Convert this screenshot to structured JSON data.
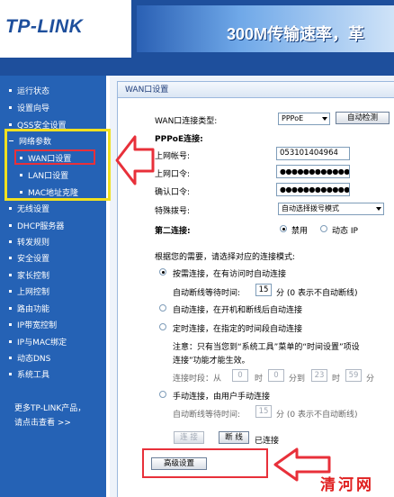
{
  "header": {
    "logo": "TP-LINK",
    "slogan": "300M传输速率，",
    "slogan_extra": "革"
  },
  "sidebar": {
    "items": [
      {
        "label": "运行状态"
      },
      {
        "label": "设置向导"
      },
      {
        "label": "QSS安全设置"
      },
      {
        "label": "网络参数"
      },
      {
        "label": "WAN口设置"
      },
      {
        "label": "LAN口设置"
      },
      {
        "label": "MAC地址克隆"
      },
      {
        "label": "无线设置"
      },
      {
        "label": "DHCP服务器"
      },
      {
        "label": "转发规则"
      },
      {
        "label": "安全设置"
      },
      {
        "label": "家长控制"
      },
      {
        "label": "上网控制"
      },
      {
        "label": "路由功能"
      },
      {
        "label": "IP带宽控制"
      },
      {
        "label": "IP与MAC绑定"
      },
      {
        "label": "动态DNS"
      },
      {
        "label": "系统工具"
      }
    ],
    "more_line1": "更多TP-LINK产品，",
    "more_line2": "请点击查看 >>"
  },
  "panel": {
    "title": "WAN口设置",
    "wan_type_label": "WAN口连接类型:",
    "wan_type_value": "PPPoE",
    "auto_detect_btn": "自动检测",
    "pppoe_heading": "PPPoE连接:",
    "account_label": "上网帐号:",
    "account_value": "053101404964",
    "password_label": "上网口令:",
    "password_value": "●●●●●●●●●●●●",
    "confirm_label": "确认口令:",
    "confirm_value": "●●●●●●●●●●●●",
    "dial_label": "特殊拨号:",
    "dial_value": "自动选择拨号模式",
    "second_conn_label": "第二连接:",
    "second_disable": "禁用",
    "second_dynamic": "动态 IP",
    "mode_prompt": "根据您的需要，请选择对应的连接模式:",
    "opt1_text": "按需连接，在有访问时自动连接",
    "opt1_idle_label": "自动断线等待时间:",
    "opt1_idle_value": "15",
    "opt1_idle_unit": "分 (0 表示不自动断线)",
    "opt2_text": "自动连接，在开机和断线后自动连接",
    "opt3_text": "定时连接，在指定的时间段自动连接",
    "opt3_note1": "注意：只有当您到“系统工具”菜单的“时间设置”项设",
    "opt3_note2": "连接”功能才能生效。",
    "opt3_period_label": "连接时段：从",
    "opt3_from_h": "0",
    "opt3_h1": "时",
    "opt3_from_m": "0",
    "opt3_to_label": "分到",
    "opt3_to_h": "23",
    "opt3_h2": "时",
    "opt3_to_m": "59",
    "opt3_m2": "分",
    "opt4_text": "手动连接，由用户手动连接",
    "opt4_idle_label": "自动断线等待时间:",
    "opt4_idle_value": "15",
    "opt4_idle_unit": "分 (0 表示不自动断线)",
    "connect_btn": "连 接",
    "disconnect_btn": "断 线",
    "status_text": "已连接",
    "advanced_btn": "高级设置"
  },
  "watermark": "清河网",
  "colors": {
    "sidebar_bg": "#2562b5",
    "header_bg": "#1e4f9c",
    "highlight_yellow": "#f0e020",
    "highlight_red": "#e8303a"
  }
}
